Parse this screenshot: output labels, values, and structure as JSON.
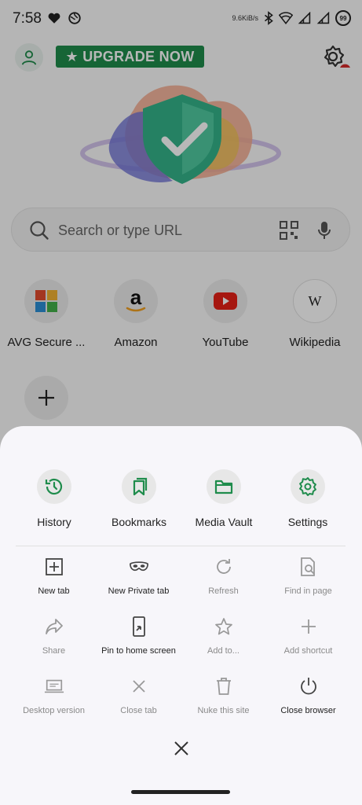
{
  "status_bar": {
    "time": "7:58",
    "net_speed": "9.6KiB/s",
    "battery_level": "99",
    "icons": [
      "heart-icon",
      "globe-icon",
      "bluetooth-icon",
      "wifi-icon",
      "signal-icon",
      "signal-icon",
      "battery-icon"
    ]
  },
  "header": {
    "upgrade_label": "★ UPGRADE NOW",
    "icons": [
      "profile-icon",
      "settings-gear-icon"
    ]
  },
  "search": {
    "placeholder": "Search or type URL",
    "icons": [
      "search-icon",
      "qr-code-icon",
      "microphone-icon"
    ]
  },
  "shortcuts": [
    {
      "label": "AVG Secure ...",
      "icon": "avg-logo-icon"
    },
    {
      "label": "Amazon",
      "icon": "amazon-logo-icon"
    },
    {
      "label": "YouTube",
      "icon": "youtube-logo-icon"
    },
    {
      "label": "Wikipedia",
      "icon": "wikipedia-logo-icon"
    }
  ],
  "menu": {
    "top_items": [
      {
        "label": "History",
        "icon": "history-icon"
      },
      {
        "label": "Bookmarks",
        "icon": "bookmarks-icon"
      },
      {
        "label": "Media Vault",
        "icon": "folder-icon"
      },
      {
        "label": "Settings",
        "icon": "gear-icon"
      }
    ],
    "grid_items": [
      {
        "label": "New tab",
        "icon": "plus-square-icon",
        "enabled": true
      },
      {
        "label": "New Private tab",
        "icon": "mask-icon",
        "enabled": true
      },
      {
        "label": "Refresh",
        "icon": "refresh-icon",
        "enabled": false
      },
      {
        "label": "Find in page",
        "icon": "find-in-page-icon",
        "enabled": false
      },
      {
        "label": "Share",
        "icon": "share-icon",
        "enabled": false
      },
      {
        "label": "Pin to home screen",
        "icon": "pin-phone-icon",
        "enabled": true
      },
      {
        "label": "Add to...",
        "icon": "star-icon",
        "enabled": false
      },
      {
        "label": "Add shortcut",
        "icon": "plus-icon",
        "enabled": false
      },
      {
        "label": "Desktop version",
        "icon": "laptop-icon",
        "enabled": false
      },
      {
        "label": "Close tab",
        "icon": "close-icon",
        "enabled": false
      },
      {
        "label": "Nuke this site",
        "icon": "trash-icon",
        "enabled": false
      },
      {
        "label": "Close browser",
        "icon": "power-icon",
        "enabled": true
      }
    ],
    "dismiss_icon": "close-icon"
  },
  "colors": {
    "accent_green": "#1f8c4c",
    "disabled_grey": "#8a8a8a"
  }
}
